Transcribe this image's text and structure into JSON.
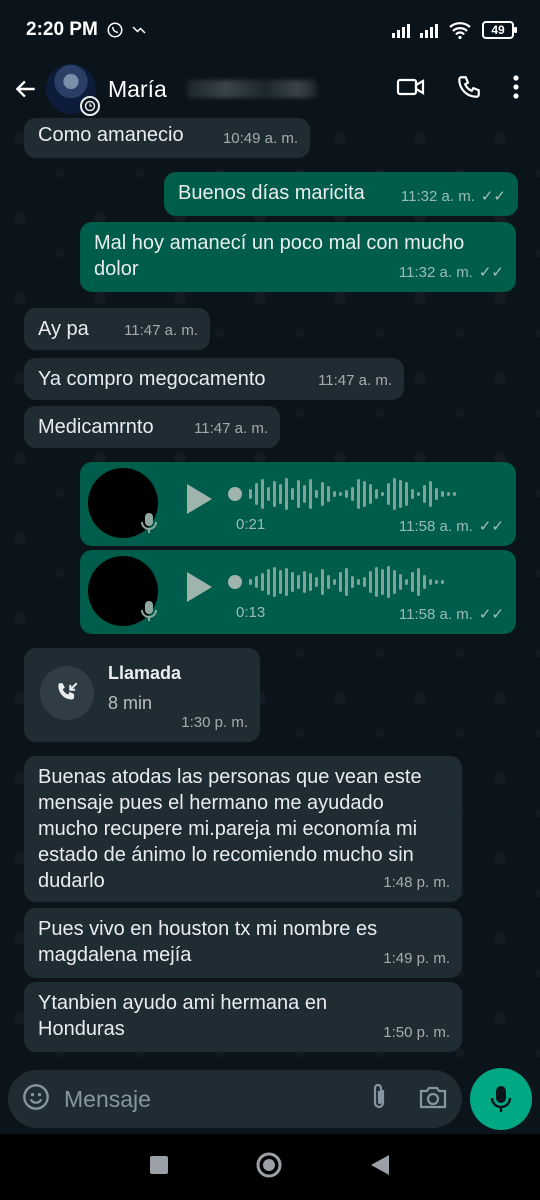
{
  "status": {
    "time": "2:20 PM",
    "battery": "49"
  },
  "header": {
    "contact_name": "María"
  },
  "messages": [
    {
      "text": "Como amanecio",
      "time": "10:49 a. m."
    },
    {
      "text": "Buenos días maricita",
      "time": "11:32 a. m."
    },
    {
      "text": "Mal hoy amanecí un poco mal con mucho dolor",
      "time": "11:32 a. m."
    },
    {
      "text": "Ay pa",
      "time": "11:47 a. m."
    },
    {
      "text": "Ya compro megocamento",
      "time": "11:47 a. m."
    },
    {
      "text": "Medicamrnto",
      "time": "11:47 a. m."
    },
    {
      "duration": "0:21",
      "time": "11:58 a. m."
    },
    {
      "duration": "0:13",
      "time": "11:58 a. m."
    },
    {
      "title": "Llamada",
      "duration": "8 min",
      "time": "1:30 p. m."
    },
    {
      "text": "Buenas atodas las personas que vean este mensaje pues el   hermano me ayudado mucho recupere mi.pareja mi economía mi estado de ánimo  lo recomiendo mucho sin dudarlo",
      "time": "1:48 p. m."
    },
    {
      "text": "Pues vivo en houston tx  mi nombre es magdalena mejía",
      "time": "1:49 p. m."
    },
    {
      "text": "Ytanbien ayudo ami hermana  en Honduras",
      "time": "1:50 p. m."
    }
  ],
  "composer": {
    "placeholder": "Mensaje"
  },
  "colors": {
    "incoming": "#202c33",
    "outgoing": "#005c4b",
    "accent": "#00a884",
    "background": "#0b141a"
  }
}
